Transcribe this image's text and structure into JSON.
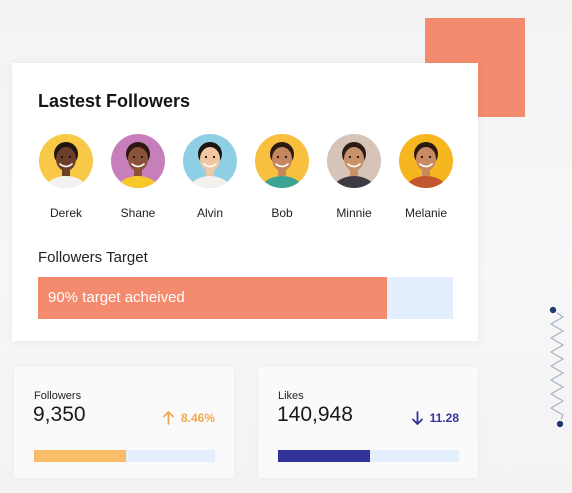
{
  "card": {
    "title": "Lastest Followers",
    "followers": [
      {
        "name": "Derek",
        "icon": "avatar-derek-icon",
        "bg": "#f8c947",
        "skin": "#6b3f2a",
        "hair": "#1e1410",
        "shirt": "#f2f2f2"
      },
      {
        "name": "Shane",
        "icon": "avatar-shane-icon",
        "bg": "#c67fbb",
        "skin": "#8a5238",
        "hair": "#2a1810",
        "shirt": "#f6c829"
      },
      {
        "name": "Alvin",
        "icon": "avatar-alvin-icon",
        "bg": "#8fcfe6",
        "skin": "#f0c7a2",
        "hair": "#1b1612",
        "shirt": "#f3f1ec"
      },
      {
        "name": "Bob",
        "icon": "avatar-bob-icon",
        "bg": "#f8c03e",
        "skin": "#c4875e",
        "hair": "#2a1a12",
        "shirt": "#3aa394"
      },
      {
        "name": "Minnie",
        "icon": "avatar-minnie-icon",
        "bg": "#d6c4b8",
        "skin": "#c9916a",
        "hair": "#2b1b14",
        "shirt": "#3d3a45"
      },
      {
        "name": "Melanie",
        "icon": "avatar-melanie-icon",
        "bg": "#f6b61f",
        "skin": "#c78a62",
        "hair": "#2b1a12",
        "shirt": "#c2562f"
      }
    ],
    "target": {
      "label": "Followers Target",
      "progress_text": "90% target acheived",
      "progress_percent": 84
    }
  },
  "stats": {
    "followers": {
      "label": "Followers",
      "value": "9,350",
      "change": "8.46%",
      "direction": "up",
      "change_color": "#f2a94d",
      "bar_fill_percent": 51,
      "bar_color": "#f8bd66"
    },
    "likes": {
      "label": "Likes",
      "value": "140,948",
      "change": "11.28",
      "direction": "down",
      "change_color": "#32329a",
      "bar_fill_percent": 51,
      "bar_color": "#32329a"
    }
  },
  "colors": {
    "accent_orange": "#f48a6e",
    "track_blue": "#e4effd",
    "deco_line": "#1f3a6e"
  }
}
